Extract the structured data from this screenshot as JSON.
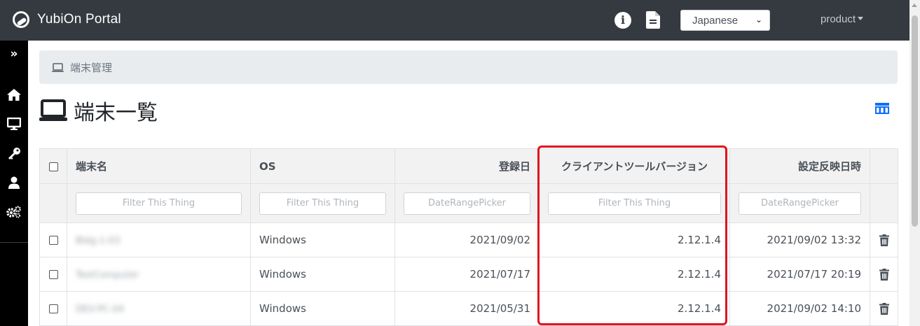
{
  "app": {
    "title": "YubiOn Portal"
  },
  "header": {
    "language": "Japanese",
    "user": "product",
    "icons": [
      "info-icon",
      "document-icon"
    ]
  },
  "sidebar": {
    "items": [
      {
        "icon": "double-chevron-right-icon"
      },
      {
        "icon": "home-icon"
      },
      {
        "icon": "monitor-icon"
      },
      {
        "icon": "key-icon"
      },
      {
        "icon": "user-icon"
      },
      {
        "icon": "gears-icon"
      }
    ]
  },
  "breadcrumb": {
    "icon": "laptop-icon",
    "text": "端末管理"
  },
  "page": {
    "title": "端末一覧",
    "icon": "laptop-icon",
    "view_toggle_icon": "columns-icon"
  },
  "table": {
    "columns": [
      "端末名",
      "OS",
      "登録日",
      "クライアントツールバージョン",
      "設定反映日時"
    ],
    "filters": [
      "Filter This Thing",
      "Filter This Thing",
      "DateRangePicker",
      "Filter This Thing",
      "DateRangePicker"
    ],
    "rows": [
      {
        "name": "Bldg-1-03",
        "os": "Windows",
        "registered": "2021/09/02",
        "version": "2.12.1.4",
        "applied": "2021/09/02 13:32"
      },
      {
        "name": "TestComputer",
        "os": "Windows",
        "registered": "2021/07/17",
        "version": "2.12.1.4",
        "applied": "2021/07/17 20:19"
      },
      {
        "name": "DEV-PC-04",
        "os": "Windows",
        "registered": "2021/05/31",
        "version": "2.12.1.4",
        "applied": "2021/09/02 14:10"
      }
    ]
  },
  "colors": {
    "navbar": "#343a40",
    "sidebar": "#000000",
    "highlight": "#e0141e",
    "accent": "#0d6efd"
  }
}
